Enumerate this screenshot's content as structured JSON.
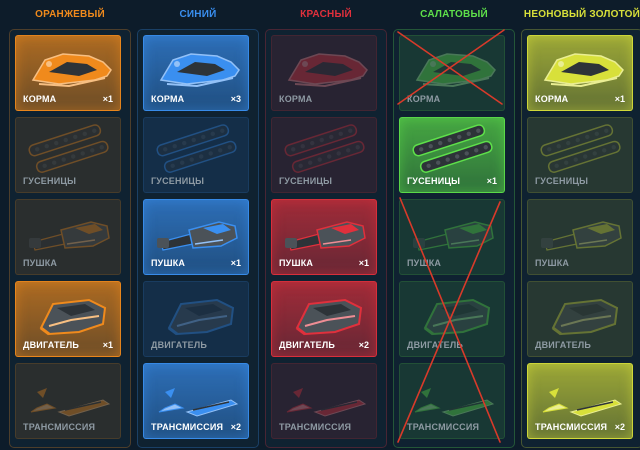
{
  "columns": [
    {
      "title": "ОРАНЖЕВЫЙ",
      "color": "#f08a1c",
      "cards": [
        {
          "label": "КОРМА",
          "count": "×1",
          "active": true,
          "icon": "hull-icon"
        },
        {
          "label": "ГУСЕНИЦЫ",
          "count": "",
          "active": false,
          "icon": "tracks-icon"
        },
        {
          "label": "ПУШКА",
          "count": "",
          "active": false,
          "icon": "cannon-icon"
        },
        {
          "label": "ДВИГАТЕЛЬ",
          "count": "×1",
          "active": true,
          "icon": "engine-icon"
        },
        {
          "label": "ТРАНСМИССИЯ",
          "count": "",
          "active": false,
          "icon": "transmission-icon"
        }
      ]
    },
    {
      "title": "СИНИЙ",
      "color": "#3a8ff0",
      "cards": [
        {
          "label": "КОРМА",
          "count": "×3",
          "active": true,
          "icon": "hull-icon"
        },
        {
          "label": "ГУСЕНИЦЫ",
          "count": "",
          "active": false,
          "icon": "tracks-icon"
        },
        {
          "label": "ПУШКА",
          "count": "×1",
          "active": true,
          "icon": "cannon-icon"
        },
        {
          "label": "ДВИГАТЕЛЬ",
          "count": "",
          "active": false,
          "icon": "engine-icon"
        },
        {
          "label": "ТРАНСМИССИЯ",
          "count": "×2",
          "active": true,
          "icon": "transmission-icon"
        }
      ]
    },
    {
      "title": "КРАСНЫЙ",
      "color": "#e0303c",
      "cards": [
        {
          "label": "КОРМА",
          "count": "",
          "active": false,
          "icon": "hull-icon"
        },
        {
          "label": "ГУСЕНИЦЫ",
          "count": "",
          "active": false,
          "icon": "tracks-icon"
        },
        {
          "label": "ПУШКА",
          "count": "×1",
          "active": true,
          "icon": "cannon-icon"
        },
        {
          "label": "ДВИГАТЕЛЬ",
          "count": "×2",
          "active": true,
          "icon": "engine-icon"
        },
        {
          "label": "ТРАНСМИССИЯ",
          "count": "",
          "active": false,
          "icon": "transmission-icon"
        }
      ]
    },
    {
      "title": "САЛАТОВЫЙ",
      "color": "#5ee04a",
      "cards": [
        {
          "label": "КОРМА",
          "count": "",
          "active": false,
          "icon": "hull-icon"
        },
        {
          "label": "ГУСЕНИЦЫ",
          "count": "×1",
          "active": true,
          "icon": "tracks-icon"
        },
        {
          "label": "ПУШКА",
          "count": "",
          "active": false,
          "icon": "cannon-icon"
        },
        {
          "label": "ДВИГАТЕЛЬ",
          "count": "",
          "active": false,
          "icon": "engine-icon"
        },
        {
          "label": "ТРАНСМИССИЯ",
          "count": "",
          "active": false,
          "icon": "transmission-icon"
        }
      ]
    },
    {
      "title": "НЕОНОВЫЙ ЗОЛОТОЙ",
      "color": "#d8e03a",
      "cards": [
        {
          "label": "КОРМА",
          "count": "×1",
          "active": true,
          "icon": "hull-icon"
        },
        {
          "label": "ГУСЕНИЦЫ",
          "count": "",
          "active": false,
          "icon": "tracks-icon"
        },
        {
          "label": "ПУШКА",
          "count": "",
          "active": false,
          "icon": "cannon-icon"
        },
        {
          "label": "ДВИГАТЕЛЬ",
          "count": "",
          "active": false,
          "icon": "engine-icon"
        },
        {
          "label": "ТРАНСМИССИЯ",
          "count": "×2",
          "active": true,
          "icon": "transmission-icon"
        }
      ]
    }
  ],
  "cross_marks": {
    "color": "#d83a2a",
    "icon": "red-cross-mark"
  }
}
